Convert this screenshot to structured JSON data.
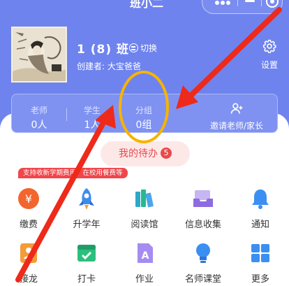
{
  "header": {
    "title": "班小二",
    "class_name": "1 (8) 班",
    "switch_label": "切换",
    "creator": "创建者: 大宝爸爸",
    "settings_label": "设置"
  },
  "stats": {
    "teachers": {
      "label": "老师",
      "value": "0人"
    },
    "students": {
      "label": "学生",
      "value": "1人"
    },
    "groups": {
      "label": "分组",
      "value": "0组"
    },
    "invite_label": "邀请老师/家长"
  },
  "todo": {
    "label": "我的待办",
    "count": "5"
  },
  "promo": "支持收新学期费用、在校用餐费等",
  "features": [
    {
      "label": "缴费",
      "icon": "yuan-coin-icon"
    },
    {
      "label": "升学年",
      "icon": "rocket-icon"
    },
    {
      "label": "阅读馆",
      "icon": "books-icon"
    },
    {
      "label": "信息收集",
      "icon": "inbox-tray-icon"
    },
    {
      "label": "通知",
      "icon": "bell-icon"
    },
    {
      "label": "接龙",
      "icon": "relay-icon"
    },
    {
      "label": "打卡",
      "icon": "calendar-check-icon"
    },
    {
      "label": "作业",
      "icon": "homework-doc-icon"
    },
    {
      "label": "名师课堂",
      "icon": "bulb-icon"
    },
    {
      "label": "更多",
      "icon": "grid-more-icon"
    }
  ],
  "colors": {
    "header_bg": "#6f83ee",
    "accent_red": "#e84a4a",
    "annotation_circle": "#f6b400",
    "annotation_arrow": "#ee2a1b"
  }
}
